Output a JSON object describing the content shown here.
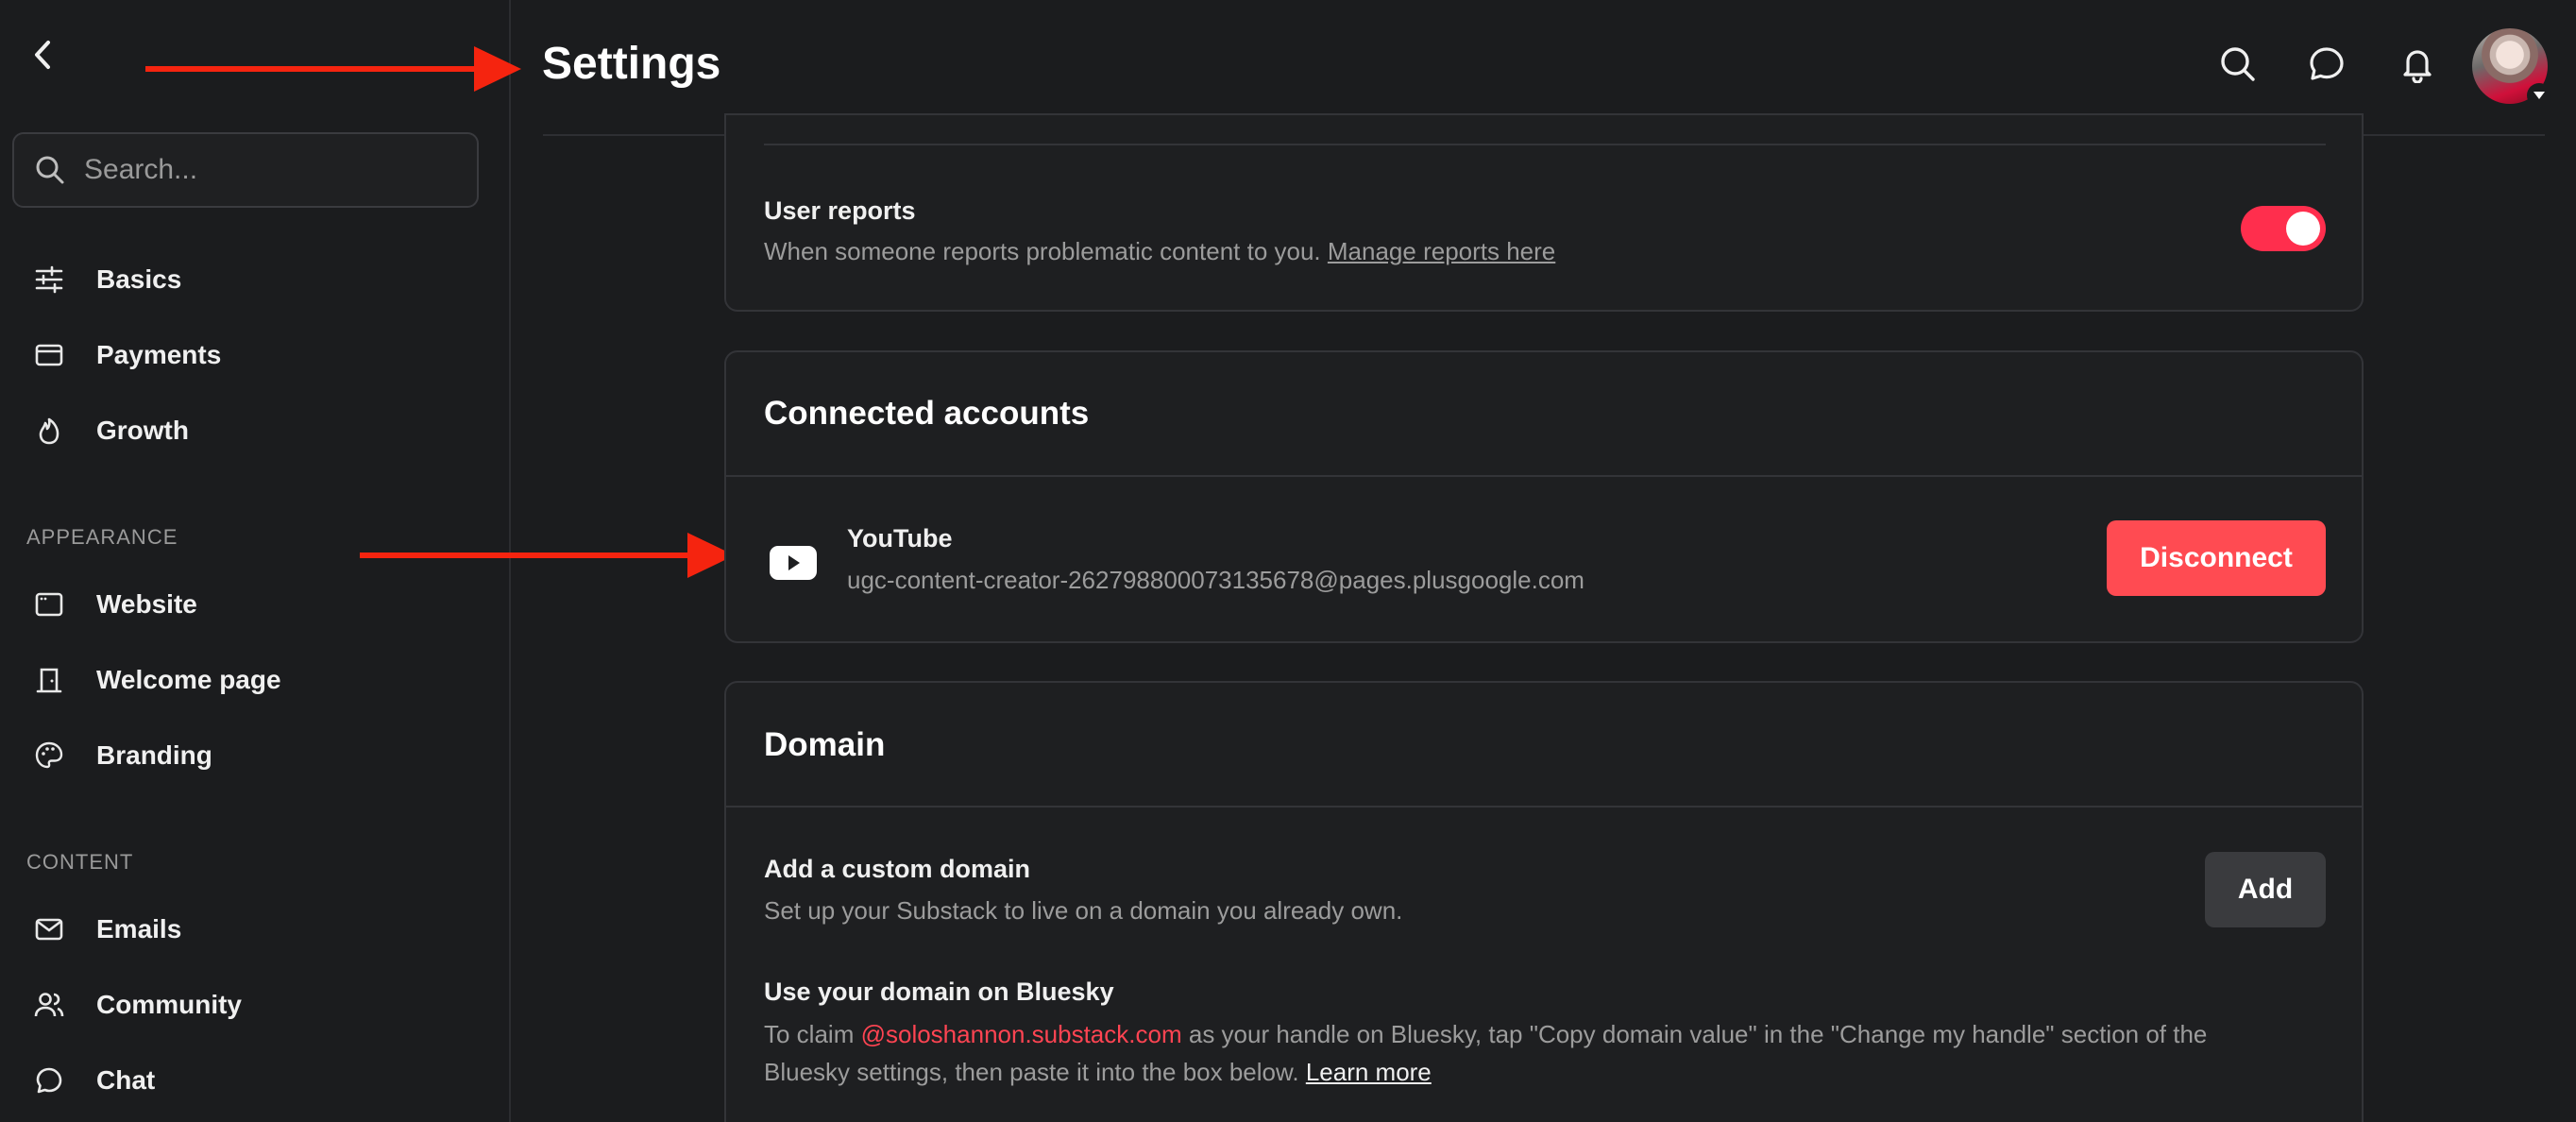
{
  "sidebar": {
    "search_placeholder": "Search...",
    "items_top": [
      {
        "label": "Basics",
        "icon": "sliders-icon"
      },
      {
        "label": "Payments",
        "icon": "credit-card-icon"
      },
      {
        "label": "Growth",
        "icon": "flame-icon"
      }
    ],
    "section_appearance": "APPEARANCE",
    "items_appearance": [
      {
        "label": "Website",
        "icon": "browser-window-icon"
      },
      {
        "label": "Welcome page",
        "icon": "welcome-door-icon"
      },
      {
        "label": "Branding",
        "icon": "palette-icon"
      }
    ],
    "section_content": "CONTENT",
    "items_content": [
      {
        "label": "Emails",
        "icon": "mail-icon"
      },
      {
        "label": "Community",
        "icon": "users-icon"
      },
      {
        "label": "Chat",
        "icon": "chat-bubble-icon"
      }
    ]
  },
  "header": {
    "title": "Settings"
  },
  "user_reports": {
    "title": "User reports",
    "description": "When someone reports problematic content to you.",
    "link": "Manage reports here",
    "enabled": true
  },
  "connected_accounts": {
    "heading": "Connected accounts",
    "service": "YouTube",
    "account": "ugc-content-creator-262798800073135678@pages.plusgoogle.com",
    "button": "Disconnect"
  },
  "domain": {
    "heading": "Domain",
    "custom_title": "Add a custom domain",
    "custom_desc": "Set up your Substack to live on a domain you already own.",
    "add_button": "Add",
    "bluesky_title": "Use your domain on Bluesky",
    "bluesky_pre": "To claim",
    "bluesky_handle": "@soloshannon.substack.com",
    "bluesky_post1": "as your handle on Bluesky, tap \"Copy domain value\" in the \"Change my handle\" section of the",
    "bluesky_post2": "Bluesky settings, then paste it into the box below.",
    "bluesky_link": "Learn more"
  },
  "colors": {
    "accent": "#ff4452",
    "toggle_on": "#ff2e4d",
    "annotation_arrow": "#f5240f",
    "background": "#1b1c1e"
  }
}
